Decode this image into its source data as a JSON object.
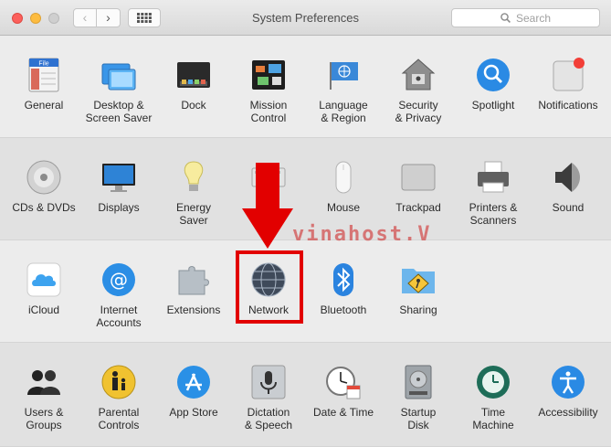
{
  "window": {
    "title": "System Preferences",
    "search_placeholder": "Search",
    "back_glyph": "‹",
    "forward_glyph": "›"
  },
  "rows": [
    {
      "items": [
        {
          "id": "general",
          "label": "General",
          "icon": "general-icon"
        },
        {
          "id": "desktop",
          "label": "Desktop &\nScreen Saver",
          "icon": "desktop-screensaver-icon"
        },
        {
          "id": "dock",
          "label": "Dock",
          "icon": "dock-icon"
        },
        {
          "id": "mission",
          "label": "Mission\nControl",
          "icon": "mission-control-icon"
        },
        {
          "id": "language",
          "label": "Language\n& Region",
          "icon": "language-region-icon"
        },
        {
          "id": "security",
          "label": "Security\n& Privacy",
          "icon": "security-privacy-icon"
        },
        {
          "id": "spotlight",
          "label": "Spotlight",
          "icon": "spotlight-icon"
        },
        {
          "id": "notifications",
          "label": "Notifications",
          "icon": "notifications-icon"
        }
      ]
    },
    {
      "items": [
        {
          "id": "cds",
          "label": "CDs & DVDs",
          "icon": "cd-dvd-icon"
        },
        {
          "id": "displays",
          "label": "Displays",
          "icon": "displays-icon"
        },
        {
          "id": "energy",
          "label": "Energy\nSaver",
          "icon": "energy-saver-icon"
        },
        {
          "id": "keyboard",
          "label": "",
          "icon": "keyboard-icon"
        },
        {
          "id": "mouse",
          "label": "Mouse",
          "icon": "mouse-icon"
        },
        {
          "id": "trackpad",
          "label": "Trackpad",
          "icon": "trackpad-icon"
        },
        {
          "id": "printers",
          "label": "Printers &\nScanners",
          "icon": "printer-icon"
        },
        {
          "id": "sound",
          "label": "Sound",
          "icon": "sound-icon"
        }
      ]
    },
    {
      "items": [
        {
          "id": "icloud",
          "label": "iCloud",
          "icon": "icloud-icon"
        },
        {
          "id": "internet",
          "label": "Internet\nAccounts",
          "icon": "internet-accounts-icon"
        },
        {
          "id": "extensions",
          "label": "Extensions",
          "icon": "extensions-icon"
        },
        {
          "id": "network",
          "label": "Network",
          "icon": "network-globe-icon"
        },
        {
          "id": "bluetooth",
          "label": "Bluetooth",
          "icon": "bluetooth-icon"
        },
        {
          "id": "sharing",
          "label": "Sharing",
          "icon": "sharing-folder-icon"
        }
      ]
    },
    {
      "items": [
        {
          "id": "users",
          "label": "Users &\nGroups",
          "icon": "users-groups-icon"
        },
        {
          "id": "parental",
          "label": "Parental\nControls",
          "icon": "parental-controls-icon"
        },
        {
          "id": "appstore",
          "label": "App Store",
          "icon": "app-store-icon"
        },
        {
          "id": "dictation",
          "label": "Dictation\n& Speech",
          "icon": "microphone-icon"
        },
        {
          "id": "datetime",
          "label": "Date & Time",
          "icon": "clock-calendar-icon"
        },
        {
          "id": "startup",
          "label": "Startup\nDisk",
          "icon": "startup-disk-icon"
        },
        {
          "id": "timemachine",
          "label": "Time\nMachine",
          "icon": "time-machine-icon"
        },
        {
          "id": "accessibility",
          "label": "Accessibility",
          "icon": "accessibility-icon"
        }
      ]
    }
  ],
  "overlay": {
    "watermark": "vinahost.V",
    "highlight_color": "#e20000"
  }
}
